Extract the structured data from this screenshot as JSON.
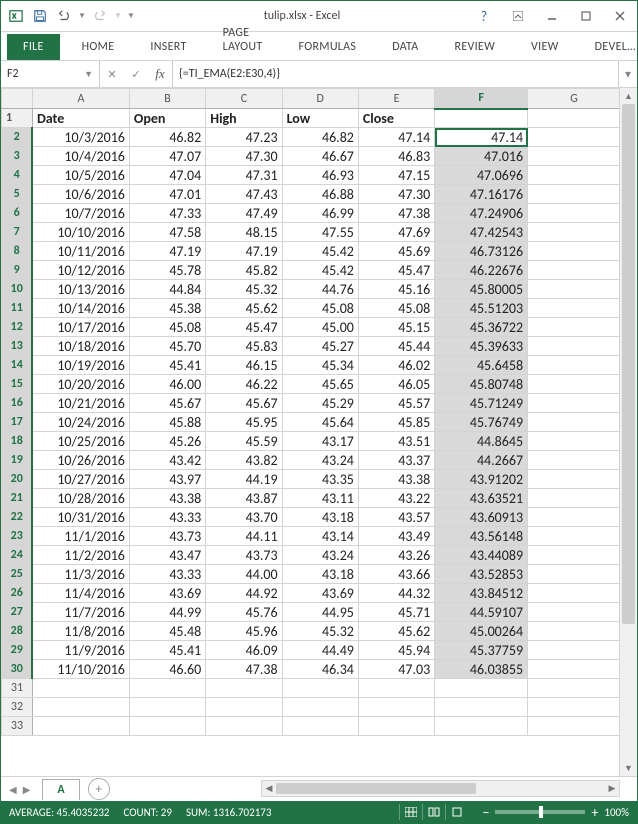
{
  "title": "tulip.xlsx - Excel",
  "ribbon_tabs": [
    "FILE",
    "HOME",
    "INSERT",
    "PAGE LAYOUT",
    "FORMULAS",
    "DATA",
    "REVIEW",
    "VIEW",
    "DEVEL…"
  ],
  "namebox": "F2",
  "formula": "{=TI_EMA(E2:E30,4)}",
  "columns": [
    "A",
    "B",
    "C",
    "D",
    "E",
    "F",
    "G"
  ],
  "header_row": [
    "Date",
    "Open",
    "High",
    "Low",
    "Close",
    "",
    ""
  ],
  "rows": [
    {
      "n": 2,
      "c": [
        "10/3/2016",
        "46.82",
        "47.23",
        "46.82",
        "47.14",
        "47.14",
        ""
      ],
      "sel": true,
      "active": true
    },
    {
      "n": 3,
      "c": [
        "10/4/2016",
        "47.07",
        "47.30",
        "46.67",
        "46.83",
        "47.016",
        ""
      ],
      "sel": true
    },
    {
      "n": 4,
      "c": [
        "10/5/2016",
        "47.04",
        "47.31",
        "46.93",
        "47.15",
        "47.0696",
        ""
      ],
      "sel": true
    },
    {
      "n": 5,
      "c": [
        "10/6/2016",
        "47.01",
        "47.43",
        "46.88",
        "47.30",
        "47.16176",
        ""
      ],
      "sel": true
    },
    {
      "n": 6,
      "c": [
        "10/7/2016",
        "47.33",
        "47.49",
        "46.99",
        "47.38",
        "47.24906",
        ""
      ],
      "sel": true
    },
    {
      "n": 7,
      "c": [
        "10/10/2016",
        "47.58",
        "48.15",
        "47.55",
        "47.69",
        "47.42543",
        ""
      ],
      "sel": true
    },
    {
      "n": 8,
      "c": [
        "10/11/2016",
        "47.19",
        "47.19",
        "45.42",
        "45.69",
        "46.73126",
        ""
      ],
      "sel": true
    },
    {
      "n": 9,
      "c": [
        "10/12/2016",
        "45.78",
        "45.82",
        "45.42",
        "45.47",
        "46.22676",
        ""
      ],
      "sel": true
    },
    {
      "n": 10,
      "c": [
        "10/13/2016",
        "44.84",
        "45.32",
        "44.76",
        "45.16",
        "45.80005",
        ""
      ],
      "sel": true
    },
    {
      "n": 11,
      "c": [
        "10/14/2016",
        "45.38",
        "45.62",
        "45.08",
        "45.08",
        "45.51203",
        ""
      ],
      "sel": true
    },
    {
      "n": 12,
      "c": [
        "10/17/2016",
        "45.08",
        "45.47",
        "45.00",
        "45.15",
        "45.36722",
        ""
      ],
      "sel": true
    },
    {
      "n": 13,
      "c": [
        "10/18/2016",
        "45.70",
        "45.83",
        "45.27",
        "45.44",
        "45.39633",
        ""
      ],
      "sel": true
    },
    {
      "n": 14,
      "c": [
        "10/19/2016",
        "45.41",
        "46.15",
        "45.34",
        "46.02",
        "45.6458",
        ""
      ],
      "sel": true
    },
    {
      "n": 15,
      "c": [
        "10/20/2016",
        "46.00",
        "46.22",
        "45.65",
        "46.05",
        "45.80748",
        ""
      ],
      "sel": true
    },
    {
      "n": 16,
      "c": [
        "10/21/2016",
        "45.67",
        "45.67",
        "45.29",
        "45.57",
        "45.71249",
        ""
      ],
      "sel": true
    },
    {
      "n": 17,
      "c": [
        "10/24/2016",
        "45.88",
        "45.95",
        "45.64",
        "45.85",
        "45.76749",
        ""
      ],
      "sel": true
    },
    {
      "n": 18,
      "c": [
        "10/25/2016",
        "45.26",
        "45.59",
        "43.17",
        "43.51",
        "44.8645",
        ""
      ],
      "sel": true
    },
    {
      "n": 19,
      "c": [
        "10/26/2016",
        "43.42",
        "43.82",
        "43.24",
        "43.37",
        "44.2667",
        ""
      ],
      "sel": true
    },
    {
      "n": 20,
      "c": [
        "10/27/2016",
        "43.97",
        "44.19",
        "43.35",
        "43.38",
        "43.91202",
        ""
      ],
      "sel": true
    },
    {
      "n": 21,
      "c": [
        "10/28/2016",
        "43.38",
        "43.87",
        "43.11",
        "43.22",
        "43.63521",
        ""
      ],
      "sel": true
    },
    {
      "n": 22,
      "c": [
        "10/31/2016",
        "43.33",
        "43.70",
        "43.18",
        "43.57",
        "43.60913",
        ""
      ],
      "sel": true
    },
    {
      "n": 23,
      "c": [
        "11/1/2016",
        "43.73",
        "44.11",
        "43.14",
        "43.49",
        "43.56148",
        ""
      ],
      "sel": true
    },
    {
      "n": 24,
      "c": [
        "11/2/2016",
        "43.47",
        "43.73",
        "43.24",
        "43.26",
        "43.44089",
        ""
      ],
      "sel": true
    },
    {
      "n": 25,
      "c": [
        "11/3/2016",
        "43.33",
        "44.00",
        "43.18",
        "43.66",
        "43.52853",
        ""
      ],
      "sel": true
    },
    {
      "n": 26,
      "c": [
        "11/4/2016",
        "43.69",
        "44.92",
        "43.69",
        "44.32",
        "43.84512",
        ""
      ],
      "sel": true
    },
    {
      "n": 27,
      "c": [
        "11/7/2016",
        "44.99",
        "45.76",
        "44.95",
        "45.71",
        "44.59107",
        ""
      ],
      "sel": true
    },
    {
      "n": 28,
      "c": [
        "11/8/2016",
        "45.48",
        "45.96",
        "45.32",
        "45.62",
        "45.00264",
        ""
      ],
      "sel": true
    },
    {
      "n": 29,
      "c": [
        "11/9/2016",
        "45.41",
        "46.09",
        "44.49",
        "45.94",
        "45.37759",
        ""
      ],
      "sel": true
    },
    {
      "n": 30,
      "c": [
        "11/10/2016",
        "46.60",
        "47.38",
        "46.34",
        "47.03",
        "46.03855",
        ""
      ],
      "sel": true
    },
    {
      "n": 31,
      "c": [
        "",
        "",
        "",
        "",
        "",
        "",
        ""
      ]
    },
    {
      "n": 32,
      "c": [
        "",
        "",
        "",
        "",
        "",
        "",
        ""
      ]
    },
    {
      "n": 33,
      "c": [
        "",
        "",
        "",
        "",
        "",
        "",
        ""
      ]
    }
  ],
  "sheet_tab": "A",
  "status": {
    "average_label": "AVERAGE:",
    "average": "45.4035232",
    "count_label": "COUNT:",
    "count": "29",
    "sum_label": "SUM:",
    "sum": "1316.702173",
    "zoom": "100%"
  }
}
